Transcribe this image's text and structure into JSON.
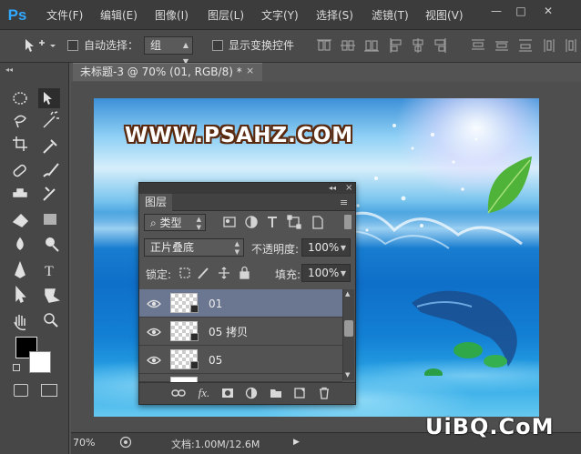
{
  "app": {
    "logo": "Ps"
  },
  "menu": [
    "文件(F)",
    "编辑(E)",
    "图像(I)",
    "图层(L)",
    "文字(Y)",
    "选择(S)",
    "滤镜(T)",
    "视图(V)"
  ],
  "window_controls": {
    "minimize": "—",
    "restore": "□",
    "close": "✕"
  },
  "options": {
    "auto_select_label": "自动选择：",
    "auto_select_value": "组",
    "show_transform_label": "显示变换控件"
  },
  "document": {
    "tab_title": "未标题-3 @ 70% (01, RGB/8) *",
    "tab_close": "×"
  },
  "watermark_text": "WWW.PSAHZ.COM",
  "layers_panel": {
    "tab_label": "图层",
    "collapse_btn": "◂◂",
    "close_btn": "×",
    "filter_kind": "类型",
    "blend_mode": "正片叠底",
    "opacity_label": "不透明度:",
    "opacity_value": "100%",
    "lock_label": "锁定:",
    "fill_label": "填充:",
    "fill_value": "100%",
    "layers": [
      {
        "name": "01",
        "selected": true
      },
      {
        "name": "05 拷贝",
        "selected": false
      },
      {
        "name": "05",
        "selected": false
      }
    ],
    "footer_icons": [
      "link-icon",
      "fx-icon",
      "mask-icon",
      "adjustment-icon",
      "group-icon",
      "new-layer-icon",
      "trash-icon"
    ],
    "footer_fx": "fx."
  },
  "status": {
    "zoom": "70%",
    "doc_size": "文档:1.00M/12.6M"
  },
  "site_mark": "UiBQ.CoM",
  "colors": {
    "accent": "#31a8ff",
    "selected_layer": "#6b7690"
  }
}
